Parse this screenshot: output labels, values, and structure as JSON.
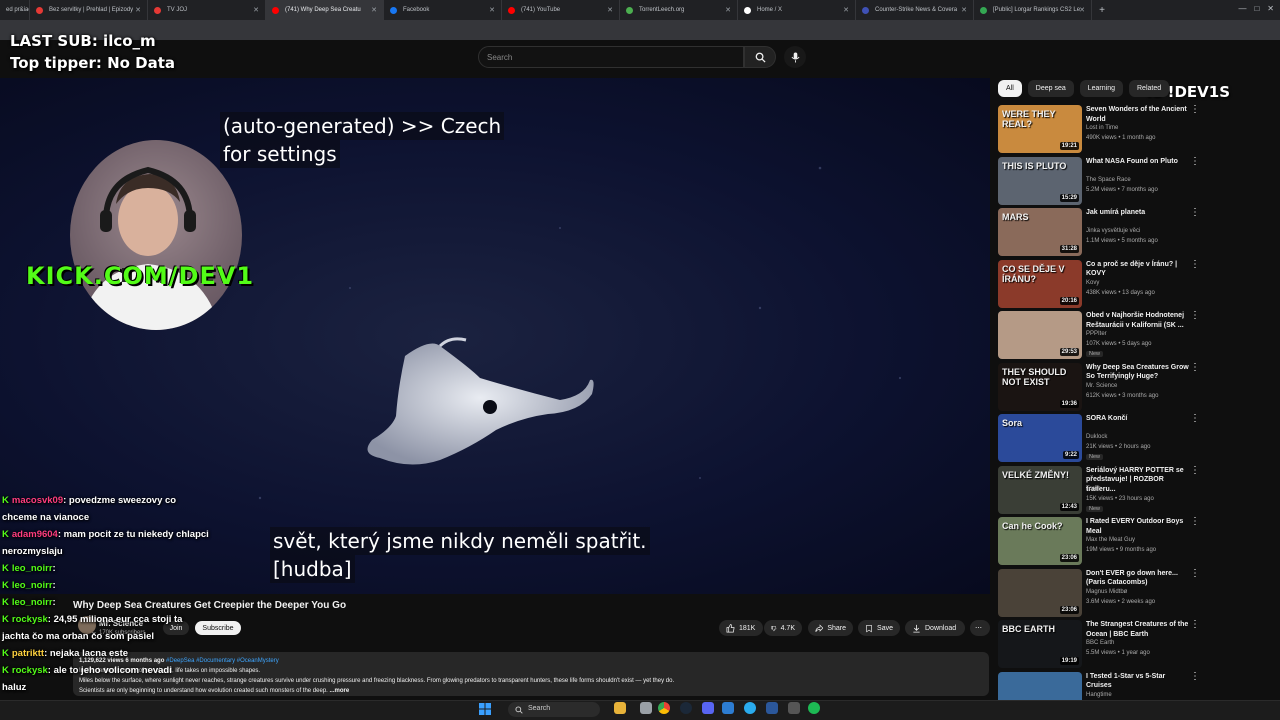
{
  "browser": {
    "tabs": [
      {
        "label": "ed pr&iacute;behy",
        "fav": "#e53935"
      },
      {
        "label": "Bez servitky | Prehlad | Epizody",
        "fav": "#e53935"
      },
      {
        "label": "TV JOJ",
        "fav": "#e53935"
      },
      {
        "label": "(741) Why Deep Sea Creatu",
        "fav": "#ff0000",
        "active": true
      },
      {
        "label": "Facebook",
        "fav": "#1877f2"
      },
      {
        "label": "(741) YouTube",
        "fav": "#ff0000"
      },
      {
        "label": "TorrentLeech.org",
        "fav": "#4caf50"
      },
      {
        "label": "Home / X",
        "fav": "#ffffff"
      },
      {
        "label": "Counter-Strike News & Covera",
        "fav": "#3f51b5"
      },
      {
        "label": "[Public] Lorgar Rankings CS2 Le",
        "fav": "#34a853"
      }
    ],
    "new_tab": "+"
  },
  "header": {
    "search_placeholder": "Search"
  },
  "stream_overlay": {
    "last_sub": "LAST SUB: ilco_m",
    "top_tipper": "Top tipper: No Data",
    "kick": "KICK.COM/DEV1",
    "dev1s": "IS !DEV1S"
  },
  "captions": {
    "settings_line1": "(auto-generated) >> Czech",
    "settings_line2": "for settings",
    "sub_line1": "svět, který jsme nikdy neměli spatřit.",
    "sub_line2": "[hudba]"
  },
  "chat": [
    {
      "user": "macosvk09",
      "msg": ": povedzme sweezovy co",
      "cont": "chceme na vianoce",
      "color": "u1"
    },
    {
      "user": "adam9604",
      "msg": ": mam pocit ze tu niekedy chlapci",
      "cont": "nerozmyslaju",
      "color": "u1"
    },
    {
      "user": "leo_noirr",
      "msg": ":",
      "cont": "",
      "color": "u3"
    },
    {
      "user": "leo_noirr",
      "msg": ":",
      "cont": "",
      "color": "u3"
    },
    {
      "user": "leo_noirr",
      "msg": ":",
      "cont": "",
      "color": "u3"
    },
    {
      "user": "rockysk",
      "msg": ": 24,95 miliona eur cca stoji ta",
      "cont": "jachta čo ma orban čo som pasiel",
      "color": "u3"
    },
    {
      "user": "patriktt",
      "msg": ": nejaka lacna este",
      "cont": "",
      "color": "u4"
    },
    {
      "user": "rockysk",
      "msg": ": ale to jeho volicom nevadi",
      "cont": "haluz",
      "color": "u3"
    }
  ],
  "video": {
    "title": "Why Deep Sea Creatures Get Creepier the Deeper You Go",
    "channel": "Mr. Science",
    "subscribers": "170K subscribers",
    "join": "Join",
    "subscribe": "Subscribe",
    "likes": "181K",
    "dislikes": "4.7K",
    "share": "Share",
    "save": "Save",
    "download": "Download",
    "more": "⋯",
    "desc_meta": "1,129,622 views 6 months ago",
    "desc_tags": "#DeepSea #Documentary #OceanMystery",
    "desc_line1": "In the darkest corners of our planet, life takes on impossible shapes.",
    "desc_line2": "Miles below the surface, where sunlight never reaches, strange creatures survive under crushing pressure and freezing blackness. From glowing predators to transparent hunters, these life forms shouldn't exist — yet they do.",
    "desc_line3": "Scientists are only beginning to understand how evolution created such monsters of the deep.",
    "desc_more": "...more"
  },
  "sidebar": {
    "chips": [
      "All",
      "Deep sea",
      "Learning",
      "Related"
    ],
    "items": [
      {
        "title": "Seven Wonders of the Ancient World",
        "channel": "Lost in Time",
        "stats": "490K views • 1 month ago",
        "duration": "19:21",
        "thumb_text": "WERE THEY REAL?",
        "bg": "#c98a3e",
        "new": ""
      },
      {
        "title": "What NASA Found on Pluto",
        "channel": "The Space Race",
        "stats": "5.2M views • 7 months ago",
        "duration": "15:29",
        "thumb_text": "THIS IS PLUTO",
        "bg": "#5c6470",
        "new": ""
      },
      {
        "title": "Jak umírá planeta",
        "channel": "Jinka vysvětluje věci",
        "stats": "1.1M views • 5 months ago",
        "duration": "31:28",
        "thumb_text": "MARS",
        "bg": "#8a6a5a",
        "new": ""
      },
      {
        "title": "Co a proč se děje v Íránu? | KOVY",
        "channel": "Kovy",
        "stats": "438K views • 13 days ago",
        "duration": "20:16",
        "thumb_text": "CO SE DĚJE V ÍRÁNU?",
        "bg": "#8b3a2a",
        "new": ""
      },
      {
        "title": "Obed v Najhoršie Hodnotenej Reštaurácii v Kalifornii (SK ...",
        "channel": "PPPIter",
        "stats": "107K views • 5 days ago",
        "duration": "29:53",
        "thumb_text": "",
        "bg": "#b59a86",
        "new": "New"
      },
      {
        "title": "Why Deep Sea Creatures Grow So Terrifyingly Huge?",
        "channel": "Mr. Science",
        "stats": "612K views • 3 months ago",
        "duration": "19:36",
        "thumb_text": "THEY SHOULD NOT EXIST",
        "bg": "#1a1412",
        "new": ""
      },
      {
        "title": "SORA Končí",
        "channel": "Duklock",
        "stats": "21K views • 2 hours ago",
        "duration": "9:22",
        "thumb_text": "Sora",
        "bg": "#2b4a9a",
        "new": "New"
      },
      {
        "title": "Seriálový HARRY POTTER se představuje! | ROZBOR traileru...",
        "channel": "Toren",
        "stats": "15K views • 23 hours ago",
        "duration": "12:43",
        "thumb_text": "VELKÉ ZMĚNY!",
        "bg": "#3a3e36",
        "new": "New"
      },
      {
        "title": "I Rated EVERY Outdoor Boys Meal",
        "channel": "Max the Meat Guy",
        "stats": "19M views • 9 months ago",
        "duration": "23:06",
        "thumb_text": "Can he Cook?",
        "bg": "#6a7a5a",
        "new": ""
      },
      {
        "title": "Don't EVER go down here... (Paris Catacombs)",
        "channel": "Magnus Midtbø",
        "stats": "3.6M views • 2 weeks ago",
        "duration": "23:06",
        "thumb_text": "",
        "bg": "#4a4238",
        "new": ""
      },
      {
        "title": "The Strangest Creatures of the Ocean | BBC Earth",
        "channel": "BBC Earth",
        "stats": "5.5M views • 1 year ago",
        "duration": "19:19",
        "thumb_text": "BBC EARTH",
        "bg": "#15171a",
        "new": ""
      },
      {
        "title": "I Tested 1-Star vs 5-Star Cruises",
        "channel": "Hangtime",
        "stats": "",
        "duration": "",
        "thumb_text": "",
        "bg": "#3a6a9a",
        "new": ""
      }
    ]
  },
  "taskbar": {
    "search": "Search"
  }
}
